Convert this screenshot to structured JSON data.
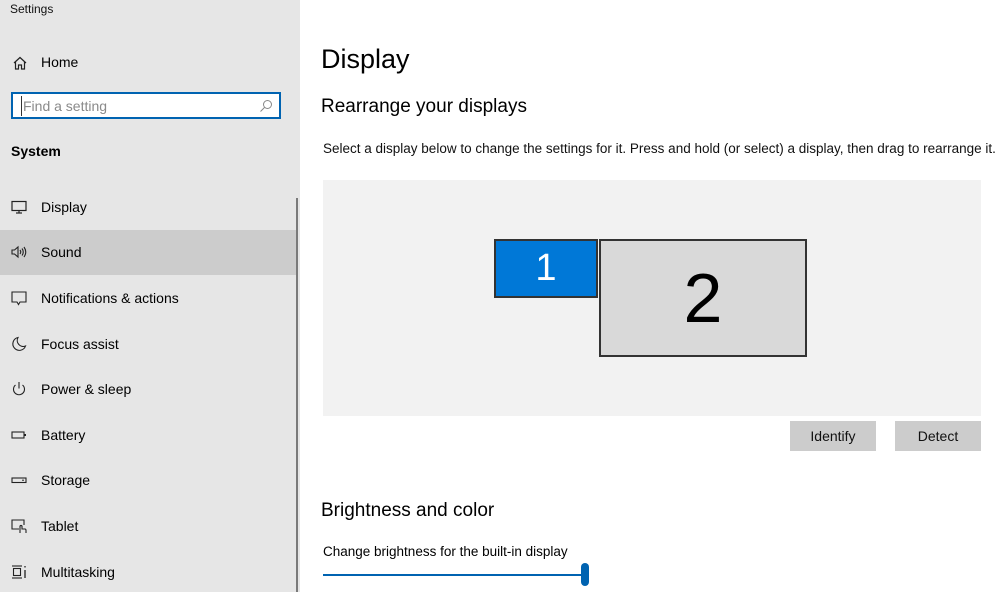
{
  "app_title": "Settings",
  "sidebar": {
    "home_label": "Home",
    "search_placeholder": "Find a setting",
    "section_label": "System",
    "items": [
      {
        "label": "Display",
        "icon": "monitor-icon",
        "active": false
      },
      {
        "label": "Sound",
        "icon": "speaker-icon",
        "active": true
      },
      {
        "label": "Notifications & actions",
        "icon": "notification-icon",
        "active": false
      },
      {
        "label": "Focus assist",
        "icon": "moon-icon",
        "active": false
      },
      {
        "label": "Power & sleep",
        "icon": "power-icon",
        "active": false
      },
      {
        "label": "Battery",
        "icon": "battery-icon",
        "active": false
      },
      {
        "label": "Storage",
        "icon": "storage-icon",
        "active": false
      },
      {
        "label": "Tablet",
        "icon": "tablet-icon",
        "active": false
      },
      {
        "label": "Multitasking",
        "icon": "multitasking-icon",
        "active": false
      }
    ]
  },
  "main": {
    "title": "Display",
    "rearrange_heading": "Rearrange your displays",
    "rearrange_desc": "Select a display below to change the settings for it. Press and hold (or select) a display, then drag to rearrange it.",
    "monitors": [
      {
        "label": "1",
        "selected": true
      },
      {
        "label": "2",
        "selected": false
      }
    ],
    "identify_label": "Identify",
    "detect_label": "Detect",
    "brightness_heading": "Brightness and color",
    "brightness_label": "Change brightness for the built-in display",
    "brightness_value": 100
  },
  "colors": {
    "accent": "#0078d7",
    "accent_dark": "#0063b1",
    "sidebar_bg": "#e6e6e6",
    "active_item_bg": "#cccccc"
  }
}
